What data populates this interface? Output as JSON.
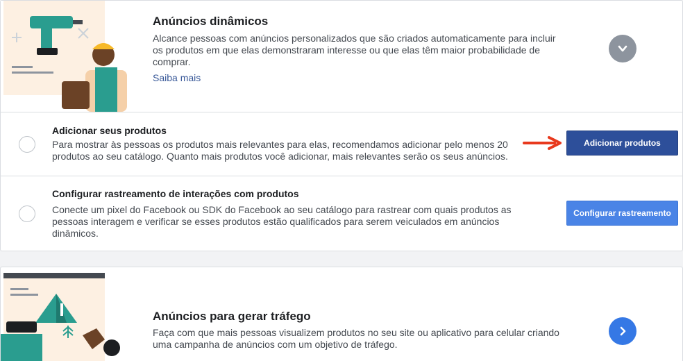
{
  "dynamic_ads": {
    "title": "Anúncios dinâmicos",
    "description_lines": [
      "Alcance pessoas com anúncios personalizados que são criados automaticamente para incluir",
      "os produtos em que elas demonstraram interesse ou que elas têm maior probabilidade de",
      "comprar."
    ],
    "learn_more": "Saiba mais",
    "toggle_icon": "chevron-down-icon"
  },
  "steps": [
    {
      "title": "Adicionar seus produtos",
      "description_lines": [
        "Para mostrar às pessoas os produtos mais relevantes para elas, recomendamos adicionar pelo menos 20",
        "produtos ao seu catálogo. Quanto mais produtos você adicionar, mais relevantes serão os seus anúncios."
      ],
      "button_label": "Adicionar produtos"
    },
    {
      "title": "Configurar rastreamento de interações com produtos",
      "description_lines": [
        "Conecte um pixel do Facebook ou SDK do Facebook ao seu catálogo para rastrear com quais produtos as",
        "pessoas interagem e verificar se esses produtos estão qualificados para serem veiculados em anúncios",
        "dinâmicos."
      ],
      "button_label": "Configurar rastreamento"
    }
  ],
  "traffic_ads": {
    "title": "Anúncios para gerar tráfego",
    "description_lines": [
      "Faça com que mais pessoas visualizem produtos no seu site ou aplicativo para celular criando",
      "uma campanha de anúncios com um objetivo de tráfego."
    ],
    "open_icon": "chevron-right-icon"
  },
  "colors": {
    "primary_dark": "#2d4f9a",
    "primary": "#4a84e6",
    "arrow": "#e8391d",
    "link": "#385898"
  }
}
